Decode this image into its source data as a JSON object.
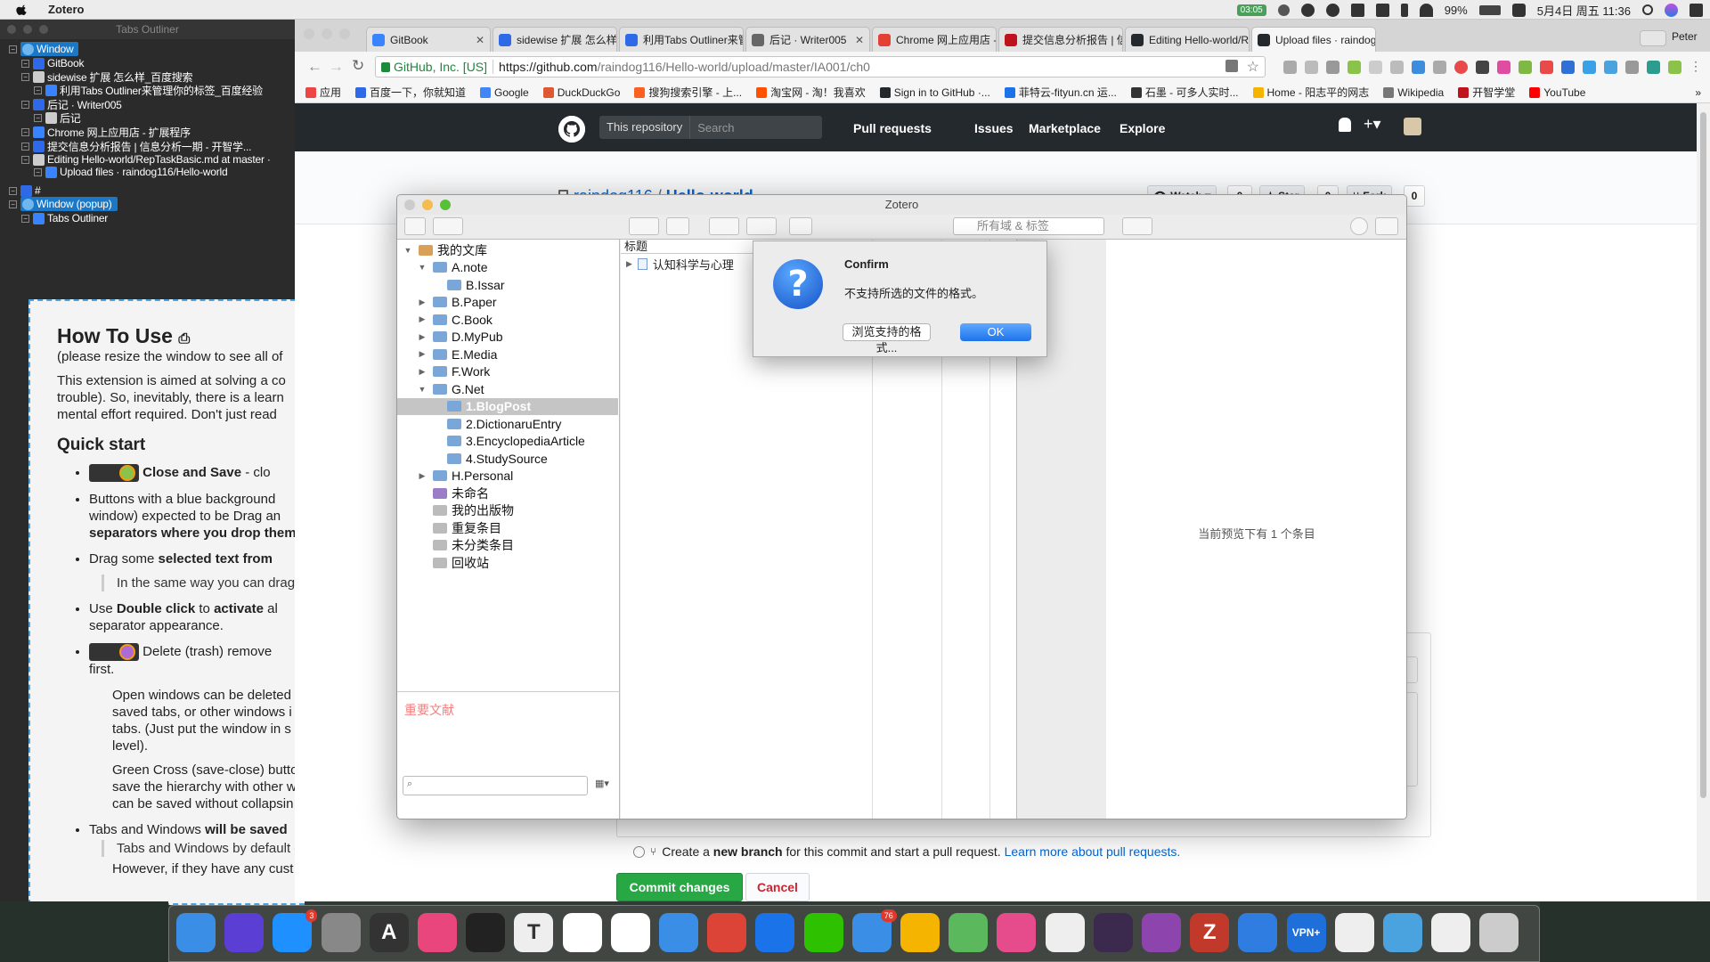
{
  "menubar": {
    "app_name": "Zotero",
    "battery_badge": "03:05",
    "battery_percent": "99%",
    "datetime": "5月4日 周五 11:36"
  },
  "tabs_outliner": {
    "title": "Tabs Outliner",
    "tree": [
      {
        "label": "Window",
        "level": 0,
        "kind": "window"
      },
      {
        "label": "GitBook",
        "level": 1
      },
      {
        "label": "sidewise 扩展 怎么样_百度搜索",
        "level": 1
      },
      {
        "label": "利用Tabs Outliner来管理你的标签_百度经验",
        "level": 2
      },
      {
        "label": "后记 · Writer005",
        "level": 1
      },
      {
        "label": "后记",
        "level": 2
      },
      {
        "label": "Chrome 网上应用店 - 扩展程序",
        "level": 1
      },
      {
        "label": "提交信息分析报告 | 信息分析一期 - 开智学...",
        "level": 1
      },
      {
        "label": "Editing Hello-world/RepTaskBasic.md at master ·",
        "level": 1
      },
      {
        "label": "Upload files · raindog116/Hello-world",
        "level": 2
      },
      {
        "label": "#",
        "level": 0
      },
      {
        "label": "Window (popup)",
        "level": 0,
        "kind": "window"
      },
      {
        "label": "Tabs Outliner",
        "level": 1
      }
    ],
    "howto": {
      "title": "How To Use",
      "subtitle": "(please resize the window to see all of",
      "intro_1": "This extension is aimed at solving a co",
      "intro_2": "trouble). So, inevitably, there is a learn",
      "intro_3": "mental effort required. Don't just read",
      "quick_start": "Quick start",
      "b1": "Close and Save",
      "b1_rest": " - clo",
      "b2_1": "Buttons with a blue background",
      "b2_2": "window) expected to be Drag an",
      "b2_3": "separators where you drop them",
      "b3_bold": "selected text from",
      "b3_pre": "Drag some ",
      "b3_indent": "In the same way you can drag",
      "b4_pre": "Use ",
      "b4_bold": "Double click",
      "b4_mid": " to ",
      "b4_bold2": "activate",
      "b4_post": " al",
      "b4_2": "separator appearance.",
      "b5": "Delete (trash) remove",
      "b5_2": "first.",
      "p_open_1": "Open windows can be deleted",
      "p_open_2": "saved tabs, or other windows i",
      "p_open_3": "tabs. (Just put the window in s",
      "p_open_4": "level).",
      "p_green_1": "Green Cross (save-close) butto",
      "p_green_2": "save the hierarchy with other w",
      "p_green_3": "can be saved without collapsin",
      "b6_pre": "Tabs and Windows ",
      "b6_bold": "will be saved",
      "b6_indent": "Tabs and Windows by default c",
      "b6_indent2": "However, if they have any cust"
    }
  },
  "chrome": {
    "profile": "Peter",
    "tabs": [
      {
        "title": "GitBook",
        "color": "#3884ff"
      },
      {
        "title": "sidewise 扩展 怎么样_百",
        "color": "#2e6ae8"
      },
      {
        "title": "利用Tabs Outliner来管",
        "color": "#2e6ae8"
      },
      {
        "title": "后记 · Writer005",
        "color": "#666"
      },
      {
        "title": "Chrome 网上应用店 -",
        "color": "#e34133"
      },
      {
        "title": "提交信息分析报告 | 信",
        "color": "#c0121c"
      },
      {
        "title": "Editing Hello-world/R",
        "color": "#24292e"
      },
      {
        "title": "Upload files · raindog",
        "color": "#24292e",
        "active": true
      }
    ],
    "secure_label": "GitHub, Inc. [US]",
    "url_scheme_host": "https://github.com",
    "url_path": "/raindog116/Hello-world/upload/master/IA001/ch0",
    "bookmarks": [
      {
        "label": "应用",
        "color": "#e44"
      },
      {
        "label": "百度一下，你就知道",
        "color": "#2e6ae8"
      },
      {
        "label": "Google",
        "color": "#4285f4"
      },
      {
        "label": "DuckDuckGo",
        "color": "#de5833"
      },
      {
        "label": "搜狗搜索引擎 - 上...",
        "color": "#fb6022"
      },
      {
        "label": "淘宝网 - 淘！我喜欢",
        "color": "#ff5000"
      },
      {
        "label": "Sign in to GitHub ·...",
        "color": "#24292e"
      },
      {
        "label": "菲特云-fityun.cn 运...",
        "color": "#1a73e8"
      },
      {
        "label": "石墨 - 可多人实时...",
        "color": "#333"
      },
      {
        "label": "Home - 阳志平的网志",
        "color": "#f4b400"
      },
      {
        "label": "Wikipedia",
        "color": "#777"
      },
      {
        "label": "开智学堂",
        "color": "#c0121c"
      },
      {
        "label": "YouTube",
        "color": "#ff0000"
      }
    ]
  },
  "github": {
    "search_scope": "This repository",
    "search_placeholder": "Search",
    "nav": [
      "Pull requests",
      "Issues",
      "Marketplace",
      "Explore"
    ],
    "owner": "raindog116",
    "separator": " / ",
    "repo": "Hello-world",
    "watch_label": "Watch ▾",
    "watch_count": "0",
    "star_label": "★ Star",
    "star_count": "0",
    "fork_label": "Fork",
    "fork_count": "0",
    "branch_text_1": "Create a ",
    "branch_text_bold": "new branch",
    "branch_text_2": " for this commit and start a pull request. ",
    "branch_link": "Learn more about pull requests.",
    "commit_label": "Commit changes",
    "cancel_label": "Cancel"
  },
  "zotero": {
    "title": "Zotero",
    "search_placeholder": "所有域 & 标签",
    "collections": [
      {
        "label": "我的文库",
        "level": 0,
        "twisty": "▼",
        "icon": "lib"
      },
      {
        "label": "A.note",
        "level": 1,
        "twisty": "▼"
      },
      {
        "label": "B.Issar",
        "level": 2,
        "twisty": ""
      },
      {
        "label": "B.Paper",
        "level": 1,
        "twisty": "▶"
      },
      {
        "label": "C.Book",
        "level": 1,
        "twisty": "▶"
      },
      {
        "label": "D.MyPub",
        "level": 1,
        "twisty": "▶"
      },
      {
        "label": "E.Media",
        "level": 1,
        "twisty": "▶"
      },
      {
        "label": "F.Work",
        "level": 1,
        "twisty": "▶"
      },
      {
        "label": "G.Net",
        "level": 1,
        "twisty": "▼"
      },
      {
        "label": "1.BlogPost",
        "level": 2,
        "twisty": "",
        "selected": true
      },
      {
        "label": "2.DictionaruEntry",
        "level": 2,
        "twisty": ""
      },
      {
        "label": "3.EncyclopediaArticle",
        "level": 2,
        "twisty": ""
      },
      {
        "label": "4.StudySource",
        "level": 2,
        "twisty": ""
      },
      {
        "label": "H.Personal",
        "level": 1,
        "twisty": "▶"
      },
      {
        "label": "未命名",
        "level": 1,
        "twisty": "",
        "icon": "sp"
      },
      {
        "label": "我的出版物",
        "level": 1,
        "twisty": "",
        "icon": "grey"
      },
      {
        "label": "重复条目",
        "level": 1,
        "twisty": "",
        "icon": "grey"
      },
      {
        "label": "未分类条目",
        "level": 1,
        "twisty": "",
        "icon": "grey"
      },
      {
        "label": "回收站",
        "level": 1,
        "twisty": "",
        "icon": "grey"
      }
    ],
    "tag_label": "重要文献",
    "items_header": "标题",
    "item_title": "认知科学与心理",
    "preview_msg": "当前预览下有 1 个条目"
  },
  "confirm_dialog": {
    "title": "Confirm",
    "message": "不支持所选的文件的格式。",
    "browse_button": "浏览支持的格式...",
    "ok_button": "OK"
  },
  "dock": {
    "apps": [
      {
        "name": "finder-icon",
        "color": "#3a8ee6"
      },
      {
        "name": "siri-icon",
        "color": "#5b3fd4"
      },
      {
        "name": "app-store-icon",
        "color": "#1e90ff",
        "badge": "3"
      },
      {
        "name": "launchpad-icon",
        "color": "#888"
      },
      {
        "name": "dictionary-icon",
        "color": "#333",
        "glyph": "A"
      },
      {
        "name": "itunes-icon",
        "color": "#e8467c"
      },
      {
        "name": "terminal-icon",
        "color": "#222"
      },
      {
        "name": "typora-icon",
        "color": "#eee",
        "glyph": "T"
      },
      {
        "name": "omnifocus-icon",
        "color": "#fff"
      },
      {
        "name": "mindnode-icon",
        "color": "#fff"
      },
      {
        "name": "things-icon",
        "color": "#3a8ee6"
      },
      {
        "name": "chrome-icon",
        "color": "#db4437"
      },
      {
        "name": "maxthon-icon",
        "color": "#1a73e8"
      },
      {
        "name": "wechat-icon",
        "color": "#2dc100"
      },
      {
        "name": "paw-icon",
        "color": "#3a8ee6",
        "badge": "76"
      },
      {
        "name": "photos-icon",
        "color": "#f4b400"
      },
      {
        "name": "notefile-icon",
        "color": "#5cb85c"
      },
      {
        "name": "display-icon",
        "color": "#e64b8b"
      },
      {
        "name": "leaf-icon",
        "color": "#eee"
      },
      {
        "name": "timing-icon",
        "color": "#3b2a4d"
      },
      {
        "name": "circle-app-icon",
        "color": "#8e44ad"
      },
      {
        "name": "zotero-icon",
        "color": "#c0392b",
        "glyph": "Z"
      },
      {
        "name": "baidu-netdisk-icon",
        "color": "#2f7de1"
      },
      {
        "name": "vpn-icon",
        "color": "#1e6fd9",
        "glyph": "VPN+"
      },
      {
        "name": "kindle-icon",
        "color": "#eee"
      },
      {
        "name": "network-icon",
        "color": "#4aa3df"
      },
      {
        "name": "activity-icon",
        "color": "#eee"
      },
      {
        "name": "trash-icon",
        "color": "#ccc"
      }
    ]
  }
}
